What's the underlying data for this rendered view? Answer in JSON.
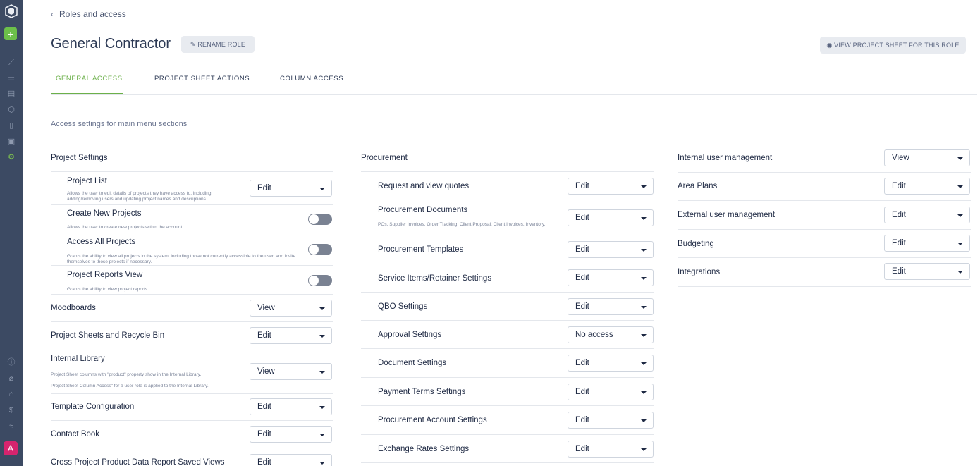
{
  "header": {
    "back_label": "Roles and access",
    "title": "General Contractor",
    "rename_label": "RENAME ROLE",
    "view_sheet_label": "VIEW PROJECT SHEET FOR THIS ROLE"
  },
  "tabs": [
    {
      "label": "GENERAL ACCESS",
      "active": true
    },
    {
      "label": "PROJECT SHEET ACTIONS",
      "active": false
    },
    {
      "label": "COLUMN ACCESS",
      "active": false
    }
  ],
  "subtitle": "Access settings for main menu sections",
  "accent_color": "#6cb04a",
  "sidebar": {
    "avatar_letter": "A",
    "icons": [
      "logo-icon",
      "add-icon",
      "chart-icon",
      "list-icon",
      "document-icon",
      "box-icon",
      "file-icon",
      "report-icon",
      "settings-icon",
      "info-icon",
      "clip-icon",
      "home-icon",
      "dollar-icon",
      "rss-icon"
    ]
  },
  "col1": {
    "heading": "Project Settings",
    "sub": [
      {
        "label": "Project List",
        "desc": "Allows the user to edit details of projects they have access to, including adding/removing users and updating project names and descriptions.",
        "value": "Edit"
      },
      {
        "label": "Create New Projects",
        "desc": "Allows the user to create new projects within the account.",
        "toggle": false
      },
      {
        "label": "Access All Projects",
        "desc": "Grants the ability to view all projects in the system, including those not currently accessible to the user, and invite themselves to those projects if necessary.",
        "toggle": false
      },
      {
        "label": "Project Reports View",
        "desc": "Grants the ability to view project reports.",
        "toggle": false
      }
    ],
    "rows": [
      {
        "label": "Moodboards",
        "value": "View"
      },
      {
        "label": "Project Sheets and Recycle Bin",
        "value": "Edit"
      },
      {
        "label": "Internal Library",
        "desc1": "Project Sheet columns with \"product\" property show in the Internal Library.",
        "desc2": "Project Sheet Column Access\" for a user role is applied to the Internal Library.",
        "value": "View"
      },
      {
        "label": "Template Configuration",
        "value": "Edit"
      },
      {
        "label": "Contact Book",
        "value": "Edit"
      },
      {
        "label": "Cross Project Product Data Report Saved Views",
        "value": "Edit"
      }
    ]
  },
  "col2": {
    "heading": "Procurement",
    "rows": [
      {
        "label": "Request and view quotes",
        "value": "Edit"
      },
      {
        "label": "Procurement Documents",
        "desc": "POs, Supplier Invoices, Order Tracking, Client Proposal, Client Invoices, Inventory.",
        "value": "Edit"
      },
      {
        "label": "Procurement Templates",
        "value": "Edit"
      },
      {
        "label": "Service Items/Retainer Settings",
        "value": "Edit"
      },
      {
        "label": "QBO Settings",
        "value": "Edit"
      },
      {
        "label": "Approval Settings",
        "value": "No access"
      },
      {
        "label": "Document Settings",
        "value": "Edit"
      },
      {
        "label": "Payment Terms Settings",
        "value": "Edit"
      },
      {
        "label": "Procurement Account Settings",
        "value": "Edit"
      },
      {
        "label": "Exchange Rates Settings",
        "value": "Edit"
      }
    ]
  },
  "col3": {
    "rows": [
      {
        "label": "Internal user management",
        "value": "View"
      },
      {
        "label": "Area Plans",
        "value": "Edit"
      },
      {
        "label": "External user management",
        "value": "Edit"
      },
      {
        "label": "Budgeting",
        "value": "Edit"
      },
      {
        "label": "Integrations",
        "value": "Edit"
      }
    ]
  }
}
